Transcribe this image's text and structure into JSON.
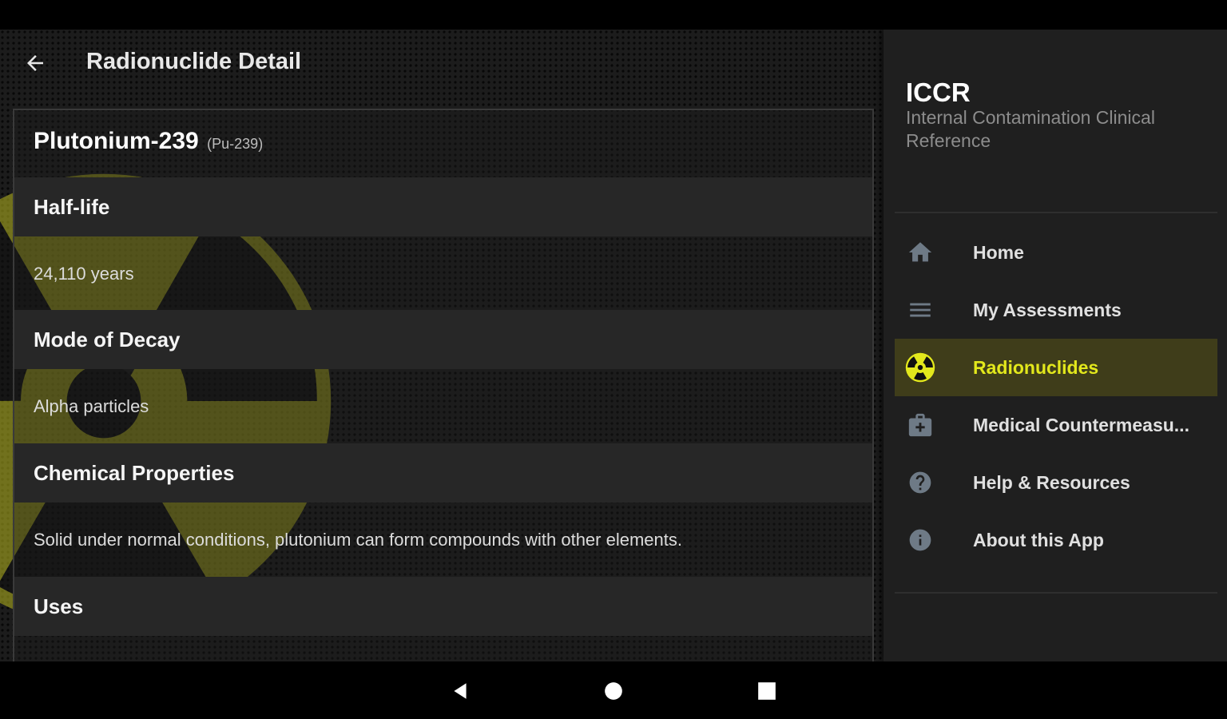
{
  "appbar": {
    "title": "Radionuclide Detail",
    "back_icon": "arrow-back-icon"
  },
  "nuclide": {
    "name": "Plutonium-239",
    "symbol": "(Pu-239)",
    "sections": [
      {
        "heading": "Half-life",
        "value": "24,110 years"
      },
      {
        "heading": "Mode of Decay",
        "value": "Alpha particles"
      },
      {
        "heading": "Chemical Properties",
        "value": "Solid under normal conditions, plutonium can form compounds with other elements."
      },
      {
        "heading": "Uses",
        "value": ""
      }
    ]
  },
  "drawer": {
    "title": "ICCR",
    "subtitle": "Internal Contamination Clinical Reference",
    "items": [
      {
        "label": "Home",
        "icon": "home-icon",
        "active": false
      },
      {
        "label": "My Assessments",
        "icon": "list-icon",
        "active": false
      },
      {
        "label": "Radionuclides",
        "icon": "radiation-icon",
        "active": true
      },
      {
        "label": "Medical Countermeasu...",
        "icon": "medical-kit-icon",
        "active": false
      },
      {
        "label": "Help & Resources",
        "icon": "help-icon",
        "active": false
      },
      {
        "label": "About this App",
        "icon": "info-icon",
        "active": false
      }
    ]
  },
  "navbar": {
    "icons": [
      "back-triangle-icon",
      "home-circle-icon",
      "recents-square-icon"
    ]
  },
  "colors": {
    "accent": "#e3e81c",
    "active_bg": "#3f3d1a",
    "drawer_bg": "#1f1f1f",
    "section_bg": "#272727",
    "hazard": "#b8b81e"
  }
}
